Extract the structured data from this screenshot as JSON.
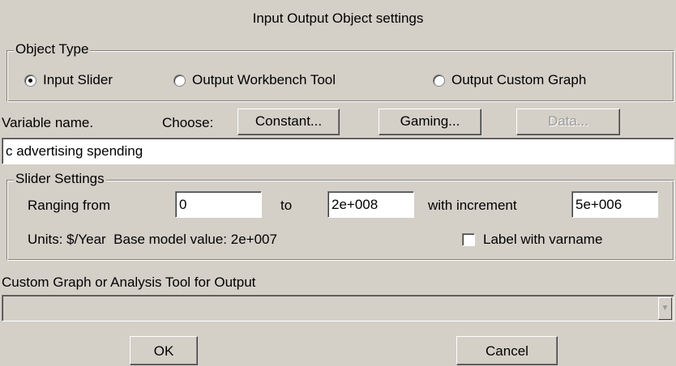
{
  "title": "Input Output Object settings",
  "object_type": {
    "legend": "Object Type",
    "options": [
      {
        "label": "Input Slider",
        "checked": true
      },
      {
        "label": "Output Workbench Tool",
        "checked": false
      },
      {
        "label": "Output Custom Graph",
        "checked": false
      }
    ]
  },
  "variable": {
    "label": "Variable name.",
    "choose_label": "Choose:",
    "constant_button": "Constant...",
    "gaming_button": "Gaming...",
    "data_button": "Data...",
    "name_value": "c advertising spending"
  },
  "slider": {
    "legend": "Slider Settings",
    "ranging_from_label": "Ranging from",
    "from_value": "0",
    "to_label": "to",
    "to_value": "2e+008",
    "increment_label": "with increment",
    "increment_value": "5e+006",
    "units_text": "Units: $/Year  Base model value: 2e+007",
    "label_checkbox": "Label with varname",
    "label_checked": false
  },
  "custom_graph": {
    "label": "Custom Graph or Analysis Tool for Output",
    "selected": ""
  },
  "buttons": {
    "ok": "OK",
    "cancel": "Cancel"
  },
  "icons": {
    "dropdown": "chevron-down-icon"
  }
}
